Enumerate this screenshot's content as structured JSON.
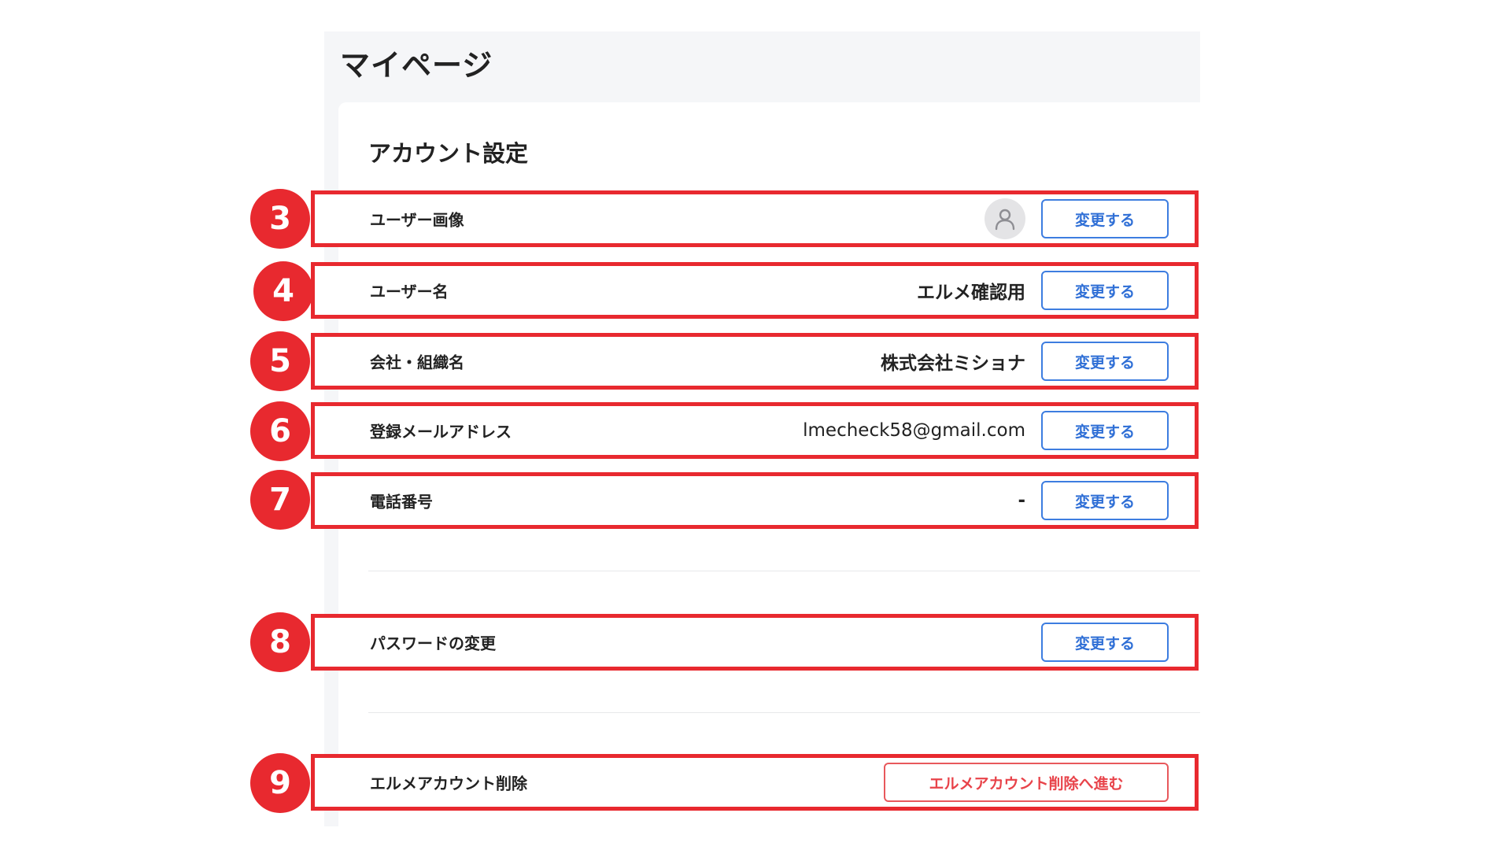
{
  "page": {
    "title": "マイページ"
  },
  "account_settings": {
    "title": "アカウント設定",
    "rows": [
      {
        "badge": "3",
        "label": "ユーザー画像",
        "value": "",
        "button": "変更する"
      },
      {
        "badge": "4",
        "label": "ユーザー名",
        "value": "エルメ確認用",
        "button": "変更する"
      },
      {
        "badge": "5",
        "label": "会社・組織名",
        "value": "株式会社ミショナ",
        "button": "変更する"
      },
      {
        "badge": "6",
        "label": "登録メールアドレス",
        "value": "lmecheck58@gmail.com",
        "button": "変更する"
      },
      {
        "badge": "7",
        "label": "電話番号",
        "value": "-",
        "button": "変更する"
      }
    ]
  },
  "password": {
    "badge": "8",
    "label": "パスワードの変更",
    "button": "変更する"
  },
  "delete_account": {
    "badge": "9",
    "label": "エルメアカウント削除",
    "button": "エルメアカウント削除へ進む"
  },
  "colors": {
    "annotation": "#e8292f",
    "primary": "#3d7de0",
    "danger": "#e8434a",
    "background": "#f5f6f8"
  },
  "icons": {
    "avatar": "user-silhouette-icon"
  }
}
